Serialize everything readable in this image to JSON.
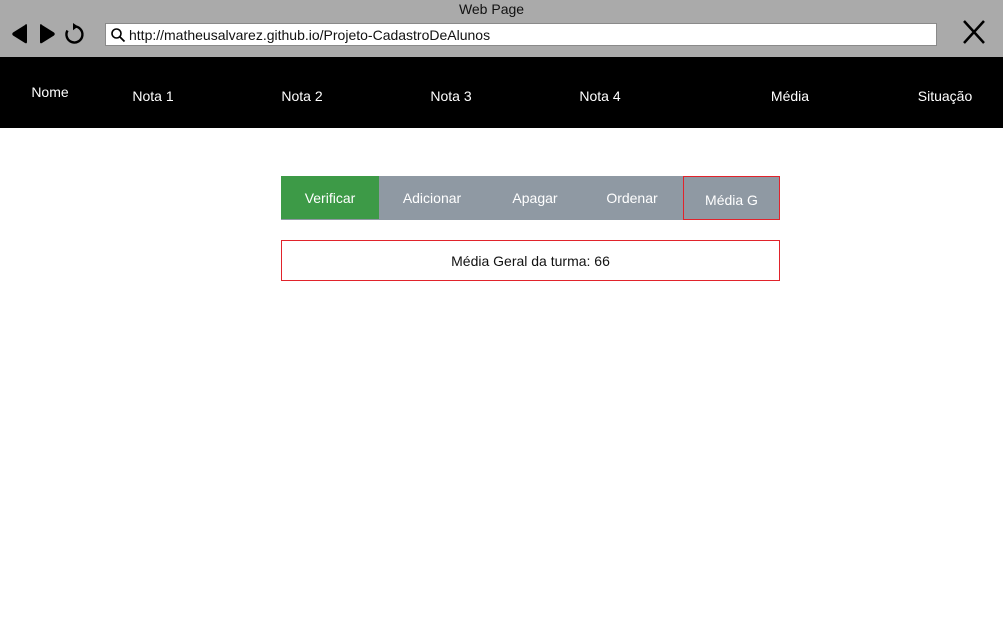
{
  "window": {
    "title": "Web Page"
  },
  "browser": {
    "url": "http://matheusalvarez.github.io/Projeto-CadastroDeAlunos",
    "back_icon": "triangle-left-icon",
    "forward_icon": "triangle-right-icon",
    "reload_icon": "reload-icon",
    "search_icon": "magnifier-icon",
    "close_icon": "x-icon"
  },
  "table": {
    "headers": [
      "Nome",
      "Nota 1",
      "Nota 2",
      "Nota 3",
      "Nota 4",
      "Média",
      "Situação"
    ]
  },
  "actions": {
    "verificar": "Verificar",
    "adicionar": "Adicionar",
    "apagar": "Apagar",
    "ordenar": "Ordenar",
    "media_g": "Média G"
  },
  "result": {
    "text": "Média Geral da turma: 66"
  },
  "colors": {
    "chrome": "#aaaaaa",
    "header_bg": "#000000",
    "button_group": "#8f99a3",
    "verificar": "#3d9a47",
    "highlight_border": "#e1232b"
  }
}
